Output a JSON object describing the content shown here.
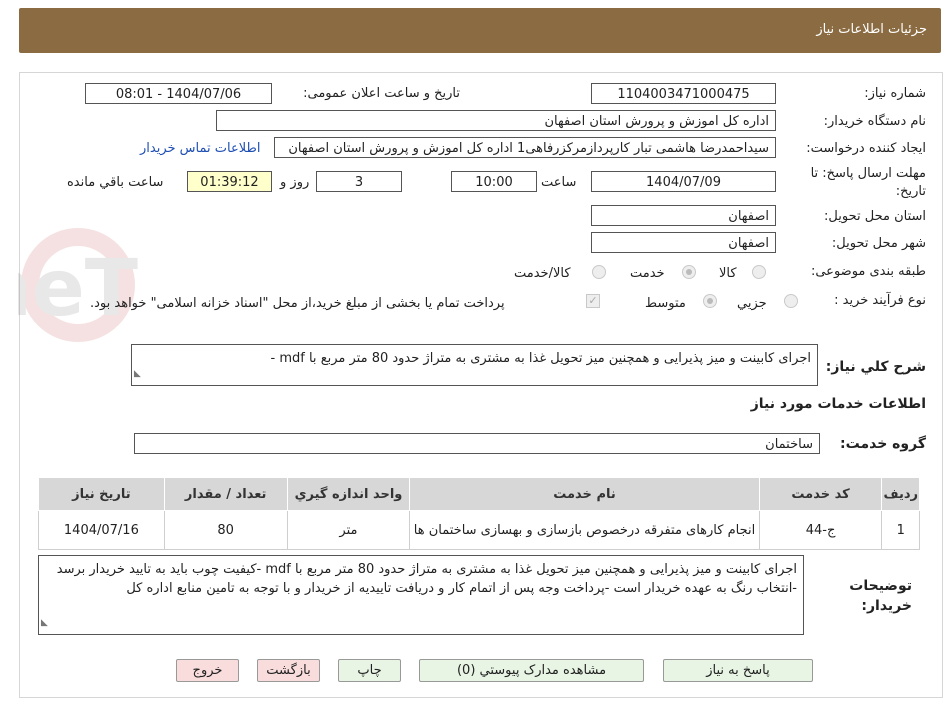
{
  "header": {
    "title": "جزئیات اطلاعات نیاز"
  },
  "form": {
    "need_number_label": "شماره نیاز:",
    "need_number": "1104003471000475",
    "announce_label": "تاریخ و ساعت اعلان عمومی:",
    "announce_value": "1404/07/06 - 08:01",
    "buyer_org_label": "نام دستگاه خریدار:",
    "buyer_org": "اداره کل اموزش و پرورش استان اصفهان",
    "creator_label": "ایجاد کننده درخواست:",
    "creator": "سیداحمدرضا هاشمی تبار کارپردازمرکزرفاهی1 اداره کل اموزش و پرورش استان اصفهان",
    "contact_link": "اطلاعات تماس خریدار",
    "deadline_label_1": "مهلت ارسال پاسخ: تا",
    "deadline_label_2": "تاریخ:",
    "deadline_date": "1404/07/09",
    "hour_label": "ساعت",
    "deadline_time": "10:00",
    "days_value": "3",
    "days_label": "روز و",
    "remaining_time": "01:39:12",
    "remaining_label": "ساعت باقي مانده",
    "province_label": "استان محل تحویل:",
    "province": "اصفهان",
    "city_label": "شهر محل تحویل:",
    "city": "اصفهان",
    "category_label": "طبقه بندی موضوعی:",
    "category_options": [
      "کالا",
      "خدمت",
      "کالا/خدمت"
    ],
    "category_selected": "خدمت",
    "process_label": "نوع فرآیند خرید :",
    "process_options": [
      "جزیي",
      "متوسط"
    ],
    "process_selected": "متوسط",
    "payment_note": "پرداخت تمام یا بخشی از مبلغ خرید،از محل \"اسناد خزانه اسلامی\" خواهد بود.",
    "summary_label": "شرح كلي نياز:",
    "summary": "اجرای کابینت و میز پذیرایی و همچنین میز تحویل غذا به مشتری به متراژ حدود 80 متر مربع با mdf -"
  },
  "services": {
    "section_title": "اطلاعات خدمات مورد نياز",
    "group_label": "گروه خدمت:",
    "group_value": "ساختمان",
    "columns": [
      "رديف",
      "کد خدمت",
      "نام خدمت",
      "واحد اندازه گيري",
      "تعداد / مقدار",
      "تاريخ نياز"
    ],
    "rows": [
      {
        "index": "1",
        "code": "ج-44",
        "name": "انجام کارهای متفرقه درخصوص بازسازی و بهسازی ساختمان ها",
        "unit": "متر",
        "qty": "80",
        "date": "1404/07/16"
      }
    ]
  },
  "buyer_notes": {
    "label_1": "توضيحات",
    "label_2": "خريدار:",
    "text": "اجرای کابینت و میز پذیرایی و همچنین میز تحویل غذا به مشتری به متراژ حدود 80 متر مربع با mdf -کیفیت چوب باید به تایید خریدار برسد -انتخاب رنگ به عهده خریدار است -پرداخت وجه پس از اتمام کار و دریافت تاییدیه از خریدار و با توجه به تامین منابع اداره کل"
  },
  "buttons": {
    "reply": "پاسخ به نياز",
    "attachments": "مشاهده مدارک پيوستي (0)",
    "print": "چاپ",
    "back": "بازگشت",
    "exit": "خروج"
  },
  "watermark": {
    "text": "AriaTender.neT"
  },
  "colors": {
    "header_bg": "#8b6c42",
    "link": "#1e4fb3",
    "time_bg": "#ffffcc",
    "button_green": "#e8f4e4",
    "button_red": "#f9dcdc"
  }
}
